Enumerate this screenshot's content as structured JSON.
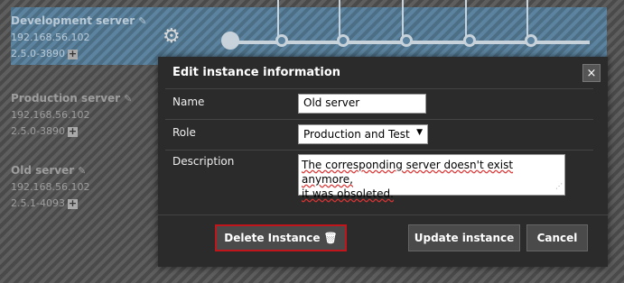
{
  "instances": [
    {
      "name": "Development server",
      "ip": "192.168.56.102",
      "version": "2.5.0-3890"
    },
    {
      "name": "Production server",
      "ip": "192.168.56.102",
      "version": "2.5.0-3890"
    },
    {
      "name": "Old server",
      "ip": "192.168.56.102",
      "version": "2.5.1-4093"
    }
  ],
  "icons": {
    "edit": "pencil-icon",
    "add": "plus-icon",
    "gear": "gear-icon",
    "trash": "trash-icon",
    "close": "close-icon"
  },
  "modal": {
    "title": "Edit instance information",
    "close_label": "×",
    "name_label": "Name",
    "name_value": "Old server",
    "role_label": "Role",
    "role_value": "Production and Test",
    "description_label": "Description",
    "description_line1": "The corresponding server doesn't exist anymore,",
    "description_line2": "it was obsoleted.",
    "delete_label": "Delete Instance",
    "update_label": "Update instance",
    "cancel_label": "Cancel"
  },
  "colors": {
    "accent_delete_border": "#c0151a",
    "selected_row": "#5c84a0"
  }
}
